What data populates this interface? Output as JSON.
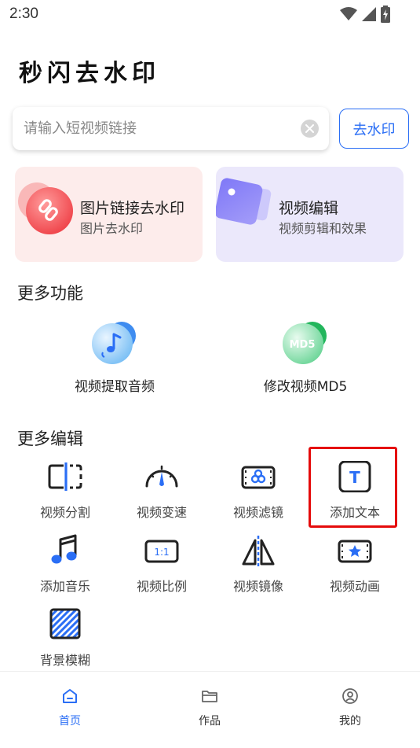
{
  "status": {
    "time": "2:30"
  },
  "app": {
    "title": "秒闪去水印"
  },
  "search": {
    "placeholder": "请输入短视频链接",
    "value": "",
    "button_label": "去水印"
  },
  "cards": [
    {
      "title": "图片链接去水印",
      "subtitle": "图片去水印",
      "icon": "link-icon"
    },
    {
      "title": "视频编辑",
      "subtitle": "视频剪辑和效果",
      "icon": "video-card-icon"
    }
  ],
  "more_features": {
    "title": "更多功能",
    "items": [
      {
        "label": "视频提取音频",
        "icon": "audio-extract-icon"
      },
      {
        "label": "修改视频MD5",
        "icon": "md5-icon",
        "icon_text": "MD5"
      }
    ]
  },
  "more_edit": {
    "title": "更多编辑",
    "tools": [
      {
        "label": "视频分割",
        "icon": "split-icon"
      },
      {
        "label": "视频变速",
        "icon": "speedometer-icon"
      },
      {
        "label": "视频滤镜",
        "icon": "filter-icon"
      },
      {
        "label": "添加文本",
        "icon": "text-icon",
        "icon_text": "T"
      },
      {
        "label": "添加音乐",
        "icon": "music-icon"
      },
      {
        "label": "视频比例",
        "icon": "ratio-icon",
        "icon_text": "1:1"
      },
      {
        "label": "视频镜像",
        "icon": "mirror-icon"
      },
      {
        "label": "视频动画",
        "icon": "star-animation-icon"
      },
      {
        "label": "背景模糊",
        "icon": "blur-icon"
      }
    ]
  },
  "nav": {
    "items": [
      {
        "label": "首页",
        "icon": "home-icon",
        "active": true
      },
      {
        "label": "作品",
        "icon": "folder-icon",
        "active": false
      },
      {
        "label": "我的",
        "icon": "profile-icon",
        "active": false
      }
    ]
  },
  "colors": {
    "accent": "#2a6ef5",
    "highlight": "#e50b0b",
    "card_pink": "#fdeceb",
    "card_purple": "#ebe8fb"
  }
}
